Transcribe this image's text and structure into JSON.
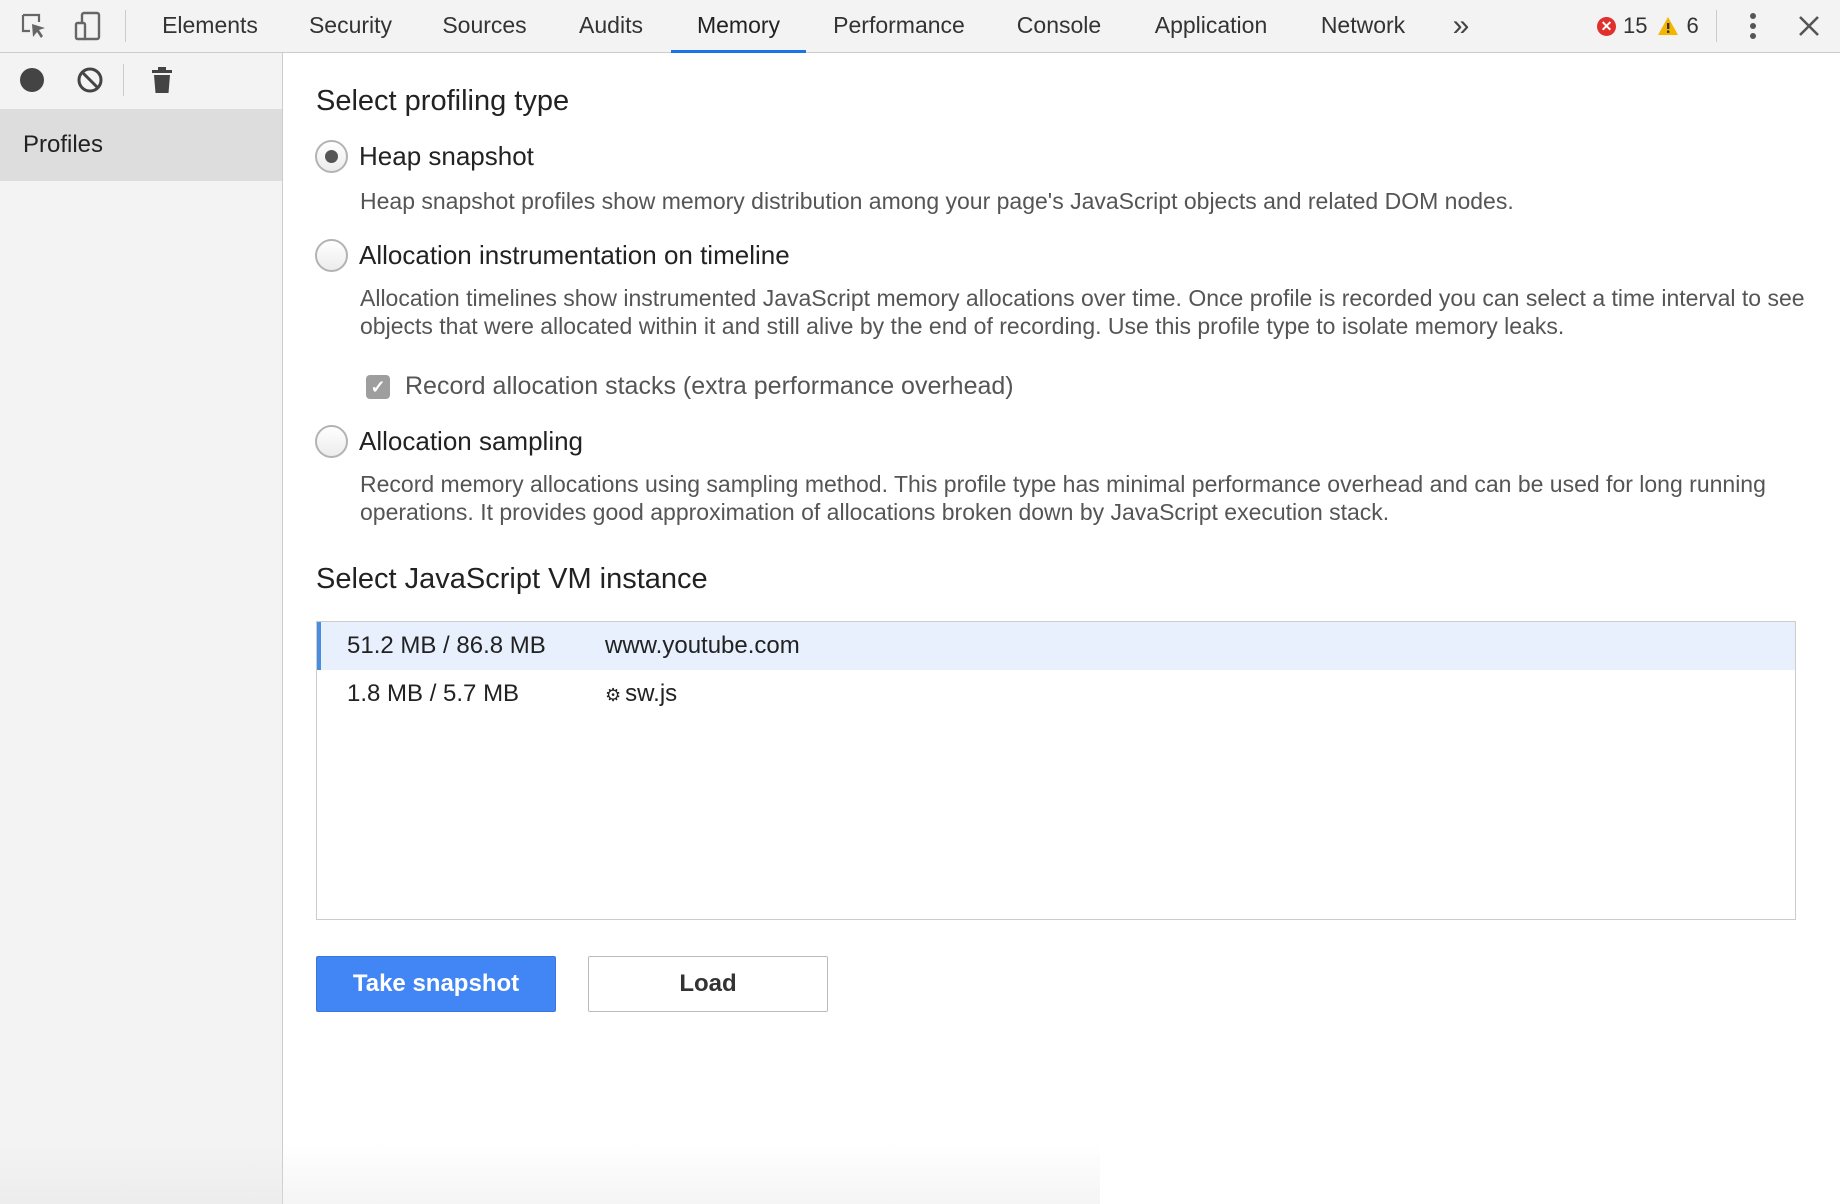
{
  "toolbar": {
    "tabs": [
      "Elements",
      "Security",
      "Sources",
      "Audits",
      "Memory",
      "Performance",
      "Console",
      "Application",
      "Network"
    ],
    "active_tab": "Memory",
    "error_count": "15",
    "warning_count": "6",
    "icons": [
      "inspect-element-icon",
      "device-toolbar-icon",
      "more-tabs-icon",
      "more-options-icon",
      "close-icon"
    ],
    "accent_color": "#1a73e8"
  },
  "sidebar": {
    "icons": [
      "record-icon",
      "clear-icon",
      "trash-icon"
    ],
    "items": [
      {
        "label": "Profiles"
      }
    ]
  },
  "profiling": {
    "heading": "Select profiling type",
    "options": [
      {
        "label": "Heap snapshot",
        "selected": true,
        "description": "Heap snapshot profiles show memory distribution among your page's JavaScript objects and related DOM nodes."
      },
      {
        "label": "Allocation instrumentation on timeline",
        "selected": false,
        "description": "Allocation timelines show instrumented JavaScript memory allocations over time. Once profile is recorded you can select a time interval to see objects that were allocated within it and still alive by the end of recording. Use this profile type to isolate memory leaks."
      },
      {
        "label": "Allocation sampling",
        "selected": false,
        "description": "Record memory allocations using sampling method. This profile type has minimal performance overhead and can be used for long running operations. It provides good approximation of allocations broken down by JavaScript execution stack."
      }
    ],
    "record_stacks": {
      "label": "Record allocation stacks (extra performance overhead)",
      "checked": true
    }
  },
  "vm": {
    "heading": "Select JavaScript VM instance",
    "instances": [
      {
        "size": "51.2 MB / 86.8 MB",
        "name": "www.youtube.com",
        "selected": true
      },
      {
        "size": "1.8 MB / 5.7 MB",
        "name": "sw.js",
        "icon": "gear-icon",
        "selected": false
      }
    ]
  },
  "actions": {
    "take_snapshot": "Take snapshot",
    "load": "Load",
    "primary_color": "#4285f4"
  }
}
